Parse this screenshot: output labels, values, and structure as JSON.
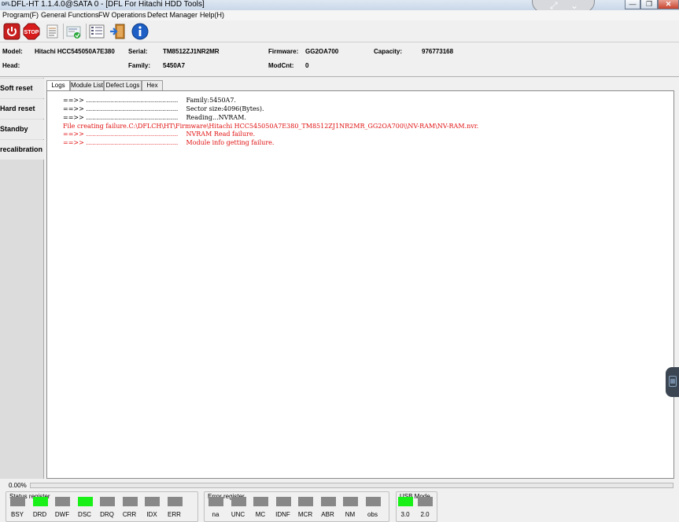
{
  "window": {
    "title": "DFL-HT 1.1.4.0@SATA 0 - [DFL For Hitachi HDD Tools]",
    "icon_text": "DFL",
    "center_tab_icons": [
      "expand-icon",
      "chevron-down-icon"
    ],
    "buttons": [
      "minimize",
      "maximize",
      "close"
    ]
  },
  "menu": {
    "items": [
      "Program(F)",
      "General Functions",
      "FW Operations",
      "Defect Manager",
      "Help(H)"
    ]
  },
  "toolbar": {
    "stop_label": "STOP",
    "icons": [
      "power-icon",
      "stop-icon",
      "list-icon",
      "module-icon",
      "grid-icon",
      "exit-icon",
      "info-icon"
    ]
  },
  "info": {
    "model_label": "Model:",
    "model_value": "Hitachi HCC545050A7E380",
    "serial_label": "Serial:",
    "serial_value": "TM8512ZJ1NR2MR",
    "firmware_label": "Firmware:",
    "firmware_value": "GG2OA700",
    "capacity_label": "Capacity:",
    "capacity_value": "976773168",
    "head_label": "Head:",
    "family_label": "Family:",
    "family_value": "5450A7",
    "modcnt_label": "ModCnt:",
    "modcnt_value": "0"
  },
  "side_panel": {
    "items": [
      "Soft reset",
      "Hard reset",
      "Standby",
      "recalibration"
    ]
  },
  "tabs": [
    "Logs",
    "Module List",
    "Defect Logs",
    "Hex"
  ],
  "logs": [
    {
      "text": "==>> ..............................................    Family:5450A7.",
      "red": false
    },
    {
      "text": "==>> ..............................................    Sector size:4096(Bytes).",
      "red": false
    },
    {
      "text": "==>> ..............................................    Reading...NVRAM.",
      "red": false
    },
    {
      "text": "File creating failure.C:\\DFLCH\\HT\\Firmware\\Hitachi HCC545050A7E380_TM8512ZJ1NR2MR_GG2OA700\\\\NV-RAM\\NV-RAM.nvr.",
      "red": true
    },
    {
      "text": "==>> ..............................................    NVRAM Read failure.",
      "red": true
    },
    {
      "text": "==>> ..............................................    Module info getting failure.",
      "red": true
    }
  ],
  "colors": {
    "log_error": "#e01010",
    "led_on": "#18f018",
    "led_off": "#888888"
  },
  "progress": {
    "text": "0.00%",
    "value": 0
  },
  "status_register": {
    "title": "Status register",
    "leds": [
      {
        "label": "BSY",
        "on": false
      },
      {
        "label": "DRD",
        "on": true
      },
      {
        "label": "DWF",
        "on": false
      },
      {
        "label": "DSC",
        "on": true
      },
      {
        "label": "DRQ",
        "on": false
      },
      {
        "label": "CRR",
        "on": false
      },
      {
        "label": "IDX",
        "on": false
      },
      {
        "label": "ERR",
        "on": false
      }
    ]
  },
  "error_register": {
    "title": "Error register",
    "leds": [
      {
        "label": "na",
        "on": false
      },
      {
        "label": "UNC",
        "on": false
      },
      {
        "label": "MC",
        "on": false
      },
      {
        "label": "IDNF",
        "on": false
      },
      {
        "label": "MCR",
        "on": false
      },
      {
        "label": "ABR",
        "on": false
      },
      {
        "label": "NM",
        "on": false
      },
      {
        "label": "obs",
        "on": false
      }
    ]
  },
  "usb_mode": {
    "title": "USB Mode",
    "leds": [
      {
        "label": "3.0",
        "on": true
      },
      {
        "label": "2.0",
        "on": false
      }
    ]
  }
}
